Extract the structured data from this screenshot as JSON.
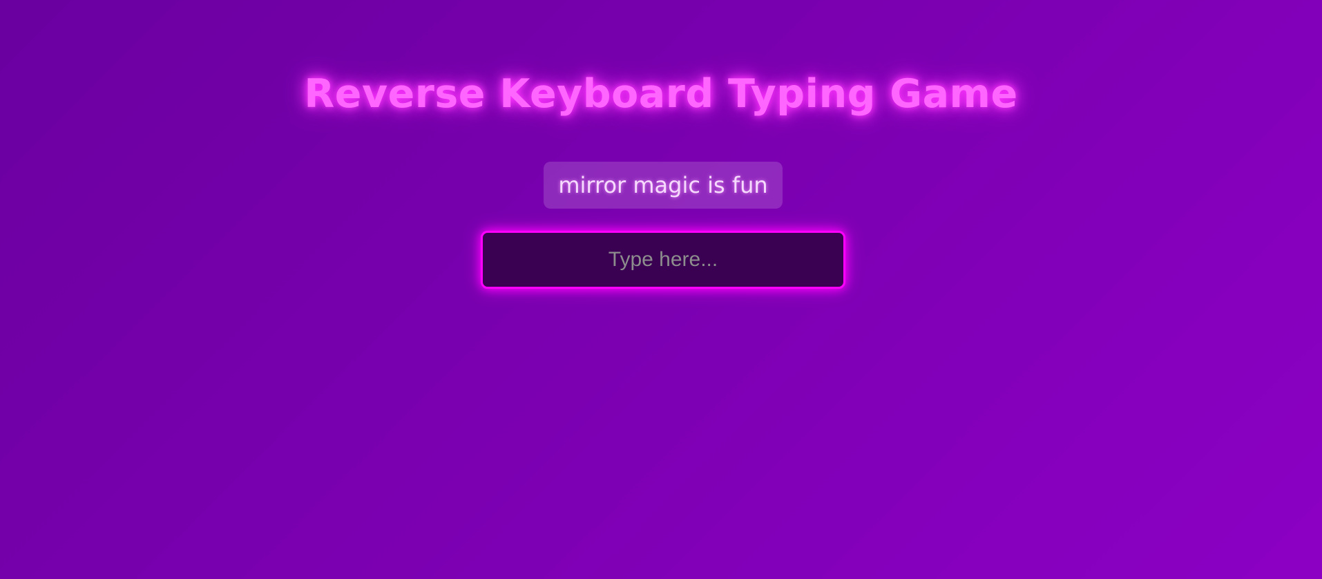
{
  "game": {
    "title": "Reverse Keyboard Typing Game",
    "target_phrase": "mirror magic is fun",
    "input": {
      "value": "",
      "placeholder": "Type here..."
    }
  },
  "colors": {
    "background_start": "#6a00a0",
    "background_end": "#8c00c4",
    "title_glow": "#ff66ff",
    "input_border": "#ff00ff",
    "input_background": "#3a0052"
  }
}
